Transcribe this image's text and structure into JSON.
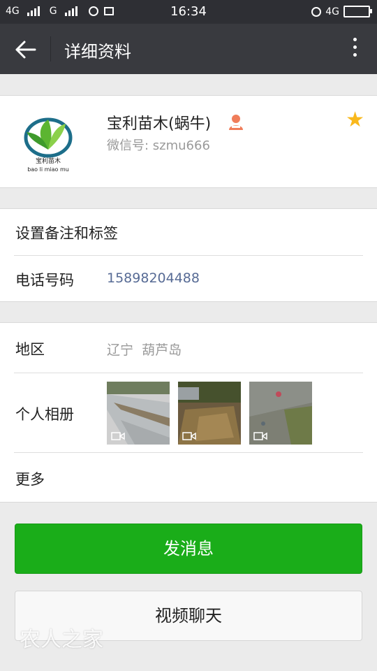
{
  "status_bar": {
    "net1": "4G",
    "net2": "G",
    "time": "16:34",
    "net3": "4G"
  },
  "header": {
    "title": "详细资料"
  },
  "profile": {
    "name": "宝利苗木(蜗牛)",
    "wechat_id": "微信号: szmu666",
    "logo_text_cn": "宝利苗木",
    "logo_text_en": "bao li miao mu",
    "starred": true
  },
  "contact": {
    "remark_label": "设置备注和标签",
    "phone_label": "电话号码",
    "phone_value": "15898204488"
  },
  "info": {
    "region_label": "地区",
    "region_value": "辽宁  葫芦岛",
    "album_label": "个人相册",
    "more_label": "更多"
  },
  "actions": {
    "send_message": "发消息",
    "video_chat": "视频聊天"
  },
  "watermark": "农人之家",
  "colors": {
    "accent_green": "#1aad19",
    "link_blue": "#576b95",
    "star": "#f9b81c"
  }
}
